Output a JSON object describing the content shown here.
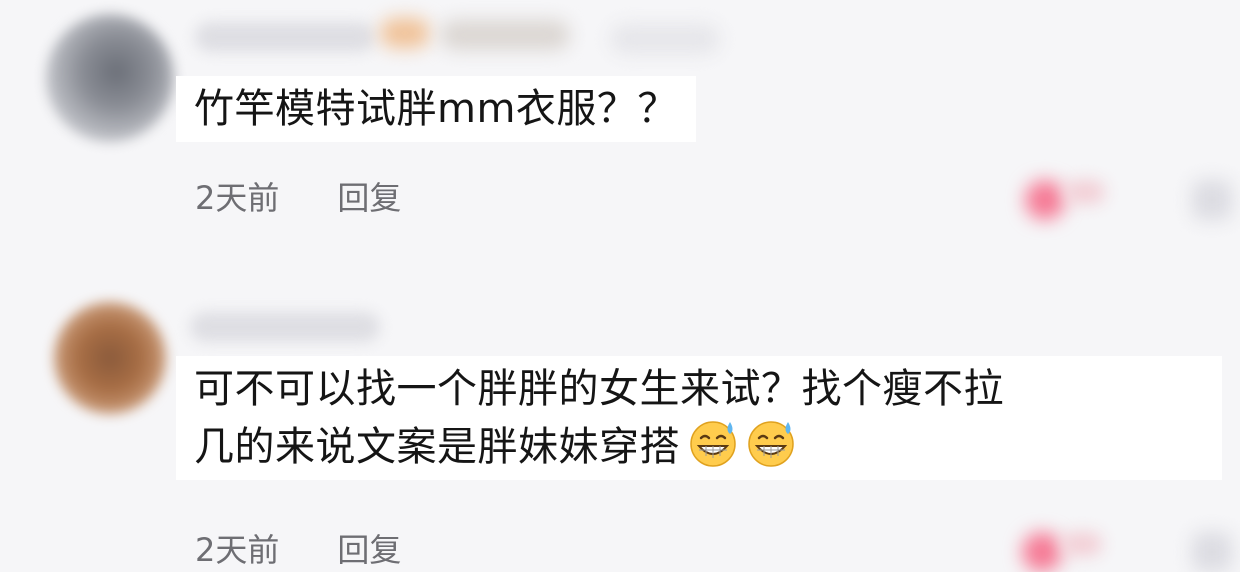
{
  "comments": [
    {
      "text": "竹竿模特试胖mm衣服？？",
      "time": "2天前",
      "reply_label": "回复"
    },
    {
      "text_line1": "可不可以找一个胖胖的女生来试？找个瘦不拉",
      "text_line2": "几的来说文案是胖妹妹穿搭",
      "emojis": [
        "grin-sweat-icon",
        "grin-sweat-icon"
      ],
      "time": "2天前",
      "reply_label": "回复"
    }
  ],
  "colors": {
    "background": "#f6f6f8",
    "comment_highlight": "#ffffff",
    "meta_text": "#6e6e73",
    "like_accent": "#f57a95"
  }
}
